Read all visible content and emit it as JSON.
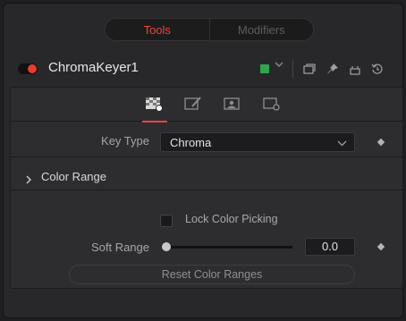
{
  "tabs": {
    "tools_label": "Tools",
    "modifiers_label": "Modifiers",
    "active": "Tools"
  },
  "header": {
    "tool_name": "ChromaKeyer1",
    "enabled": true,
    "tool_color": "#2ea64e"
  },
  "icons": {
    "header": [
      "toggle-switch",
      "color-swatch",
      "chevron-down",
      "copy-panel",
      "pin",
      "lock",
      "reset"
    ],
    "subtabs": [
      "key-checker-icon",
      "edit-brush-icon",
      "image-icon",
      "settings-icon"
    ]
  },
  "controls": {
    "key_type_label": "Key Type",
    "key_type_value": "Chroma",
    "color_range_title": "Color Range",
    "lock_color_picking_label": "Lock Color Picking",
    "lock_color_picking_checked": false,
    "soft_range_label": "Soft Range",
    "soft_range_value": "0.0",
    "soft_range_level": 0,
    "reset_button_label": "Reset Color Ranges"
  },
  "colors": {
    "accent": "#e8463c",
    "panel_bg": "#28282a",
    "content_bg": "#2d2d30"
  }
}
